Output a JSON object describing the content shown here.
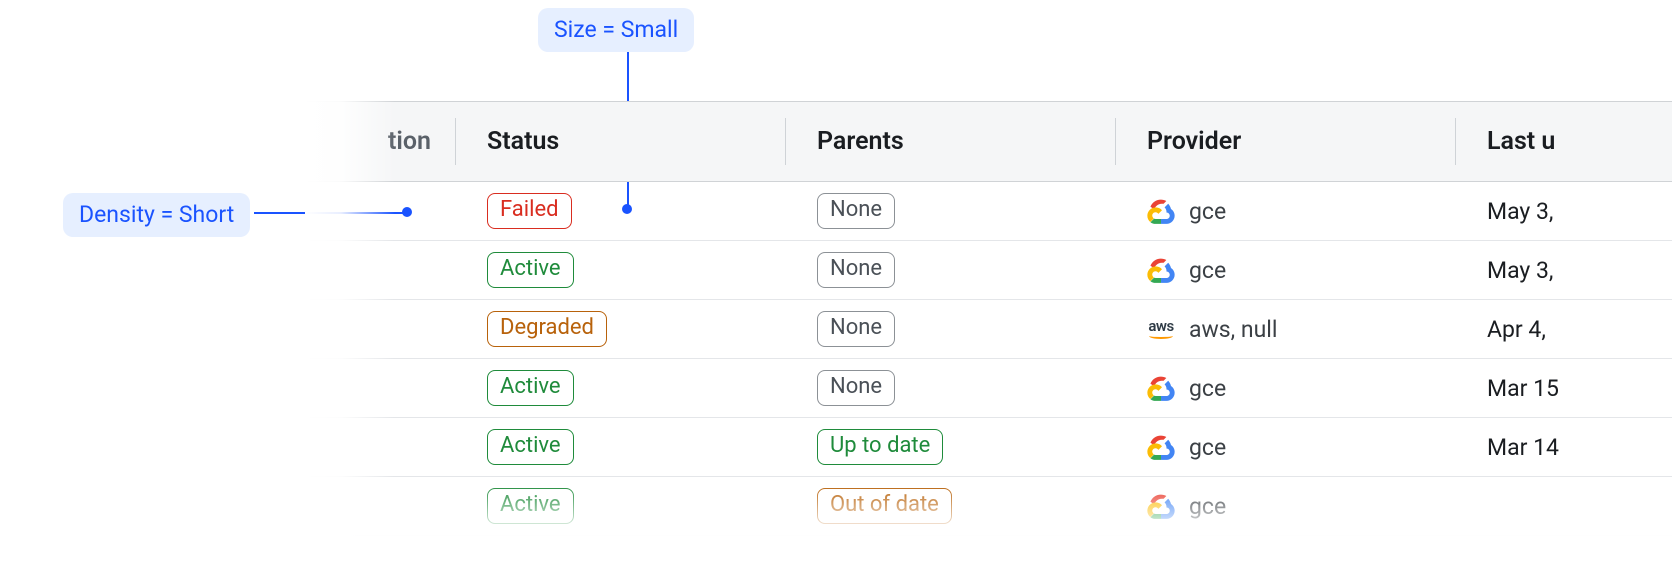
{
  "annotations": {
    "size": "Size = Small",
    "density": "Density = Short"
  },
  "columns": {
    "ation_suffix": "tion",
    "status": "Status",
    "parents": "Parents",
    "provider": "Provider",
    "last_u_prefix": "Last u"
  },
  "status_colors": {
    "Failed": "red",
    "Active": "green",
    "Degraded": "orange"
  },
  "parent_colors": {
    "None": "gray",
    "Up to date": "green",
    "Out of date": "orange"
  },
  "providers": {
    "gce": {
      "label": "gce",
      "icon": "gce"
    },
    "aws": {
      "label": "aws, null",
      "icon": "aws"
    }
  },
  "rows": [
    {
      "status": "Failed",
      "parents": "None",
      "provider": "gce",
      "last": "May 3,"
    },
    {
      "status": "Active",
      "parents": "None",
      "provider": "gce",
      "last": "May 3,"
    },
    {
      "status": "Degraded",
      "parents": "None",
      "provider": "aws",
      "last": "Apr 4,"
    },
    {
      "status": "Active",
      "parents": "None",
      "provider": "gce",
      "last": "Mar 15"
    },
    {
      "status": "Active",
      "parents": "Up to date",
      "provider": "gce",
      "last": "Mar 14"
    },
    {
      "status": "Active",
      "parents": "Out of date",
      "provider": "gce",
      "last": ""
    }
  ]
}
